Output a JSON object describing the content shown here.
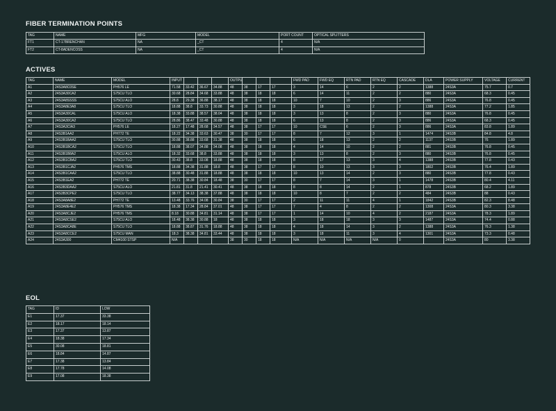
{
  "sections": {
    "ftp": "FIBER TERMINATION POINTS",
    "actives": "ACTIVES",
    "eol": "EOL"
  },
  "ftp": {
    "headers": [
      "TAG",
      "NAME",
      "MFG",
      "MODEL",
      "PORT COUNT",
      "OPTICAL SPLITTERS"
    ],
    "rows": [
      [
        "FT1",
        "CT-17BRENCHAN",
        "NA",
        "_CT",
        "4",
        "N/A"
      ],
      [
        "FT2",
        "CT-8ADENCOSS",
        "NA",
        "_CT",
        "4",
        "N/A"
      ]
    ]
  },
  "actives": {
    "headers": [
      "TAG",
      "NAME",
      "MODEL",
      "INPUT",
      "",
      "",
      "",
      "OUTPUT",
      "",
      "",
      "",
      "FWD PAD",
      "FWD EQ",
      "RTN PAD",
      "RTN EQ",
      "CASCADE",
      "DLA",
      "POWER SUPPLY",
      "VOLTAGE",
      "CURRENT"
    ],
    "rows": [
      [
        "A1",
        "24S3A8C0SE",
        "PH576 LE",
        "71.58",
        "33.42",
        "36.67",
        "34.88",
        "48",
        "38",
        "17",
        "17",
        "3",
        "14",
        "6",
        "2",
        "2",
        "1388",
        "24S3A",
        "75.7",
        "0.7"
      ],
      [
        "A2",
        "24S3A30CA2",
        "S75CU TLO",
        "30.68",
        "28.84",
        "34.68",
        "33.88",
        "48",
        "38",
        "18",
        "18",
        "6",
        "14",
        "11",
        "2",
        "2",
        "880",
        "24S3A",
        "68.3",
        "0.45"
      ],
      [
        "A3",
        "24S3A8SSSS",
        "S75CU ALO",
        "28.8",
        "29.38",
        "36.88",
        "38.17",
        "48",
        "38",
        "18",
        "18",
        "10",
        "7",
        "10",
        "2",
        "3",
        "886",
        "24S3A",
        "76.8",
        "0.45"
      ],
      [
        "A4",
        "24S3A8E3A8",
        "S75CU TLO",
        "18.88",
        "38.8",
        "33.73",
        "30.88",
        "48",
        "38",
        "18",
        "18",
        "3",
        "18",
        "13",
        "2",
        "2",
        "1388",
        "24S3A",
        "77.2",
        "1.85"
      ],
      [
        "A5",
        "24S3A30CAL",
        "S75CU ALO",
        "18.38",
        "33.88",
        "38.57",
        "38.04",
        "48",
        "38",
        "18",
        "18",
        "3",
        "13",
        "8",
        "2",
        "3",
        "880",
        "24S3A",
        "76.8",
        "0.45"
      ],
      [
        "A6",
        "24S3A30CA2",
        "S75CU TLO",
        "28.86",
        "38.47",
        "33.48",
        "30.88",
        "48",
        "38",
        "18",
        "18",
        "6",
        "13",
        "8",
        "2",
        "3",
        "886",
        "24S3A",
        "68.3",
        "0.45"
      ],
      [
        "A7",
        "24S3A3CIA3",
        "PH576 LE",
        "18.27",
        "17.48",
        "28.68",
        "34.57",
        "48",
        "38",
        "17",
        "17",
        "10",
        "CSE",
        "6",
        "2",
        "3",
        "886",
        "24S3A",
        "83.8",
        "1.89"
      ],
      [
        "A8",
        "24S3B1AA2",
        "PH772 TE",
        "18.22",
        "34.38",
        "33.63",
        "30.47",
        "38",
        "30",
        "17",
        "17",
        "8",
        "7",
        "12",
        "3",
        "1",
        "1474",
        "24S3B",
        "84.8",
        "4.8"
      ],
      [
        "A9",
        "24S3B1BAA2",
        "S75CU TLO",
        "30.88",
        "38.88",
        "33.68",
        "31.38",
        "48",
        "38",
        "18",
        "18",
        "6",
        "18",
        "13",
        "2",
        "2",
        "1137",
        "24S3B",
        "76",
        "1.89"
      ],
      [
        "A10",
        "24S3B1BCA2",
        "S75CU TLO",
        "18.88",
        "38.07",
        "34.88",
        "34.08",
        "48",
        "38",
        "18",
        "18",
        "4",
        "14",
        "10",
        "2",
        "2",
        "881",
        "24S3B",
        "76.8",
        "0.45"
      ],
      [
        "A11",
        "24S3B1B8A2",
        "S75CU ALO",
        "18.32",
        "33.68",
        "38.8",
        "33.88",
        "48",
        "38",
        "18",
        "18",
        "3",
        "13",
        "8",
        "2",
        "3",
        "880",
        "24S3B",
        "76.8",
        "0.45"
      ],
      [
        "A12",
        "24S3B1CBA2",
        "S75CU TLO",
        "30.43",
        "38.8",
        "33.08",
        "18.88",
        "48",
        "38",
        "18",
        "18",
        "8",
        "17",
        "13",
        "3",
        "4",
        "1388",
        "24S3B",
        "77.8",
        "0.43"
      ],
      [
        "A13",
        "24S3B1CJA2",
        "PH576 TMS",
        "18.88",
        "34.38",
        "31.88",
        "18.8",
        "48",
        "38",
        "17",
        "17",
        "8",
        "10",
        "13",
        "3",
        "3",
        "1802",
        "24S3B",
        "76.4",
        "1.89"
      ],
      [
        "A14",
        "24S3B1CAA2",
        "S75CU TLO",
        "38.88",
        "30.48",
        "31.88",
        "18.88",
        "48",
        "38",
        "18",
        "18",
        "10",
        "13",
        "14",
        "2",
        "3",
        "880",
        "24S3B",
        "77.8",
        "0.43"
      ],
      [
        "A15",
        "24S3B1EA2",
        "PH772 TE",
        "20.71",
        "38.38",
        "30.84",
        "18.48",
        "38",
        "30",
        "17",
        "17",
        "8",
        "7",
        "14",
        "3",
        "1",
        "1478",
        "24S3B",
        "80.4",
        "4.11"
      ],
      [
        "A16",
        "24S3B3DAA2",
        "S75CU ALO",
        "21.81",
        "31.8",
        "21.41",
        "30.41",
        "48",
        "38",
        "18",
        "18",
        "8",
        "8",
        "14",
        "2",
        "1",
        "878",
        "24S3B",
        "68.2",
        "1.89"
      ],
      [
        "A17",
        "24S3B3CPE2",
        "S75CU TLO",
        "38.77",
        "34.13",
        "38.38",
        "37.88",
        "48",
        "38",
        "18",
        "18",
        "10",
        "8",
        "7",
        "2",
        "2",
        "484",
        "24S3B",
        "88",
        "0.43"
      ],
      [
        "A18",
        "24S3A8A8E2",
        "PH772 TE",
        "13.48",
        "33.76",
        "34.08",
        "30.84",
        "38",
        "30",
        "17",
        "17",
        "2",
        "11",
        "11",
        "4",
        "1",
        "1842",
        "24S3B",
        "82.3",
        "8.48"
      ],
      [
        "A19",
        "24S3A8E4E2",
        "PH576 TMS",
        "18.38",
        "17.34",
        "28.84",
        "37.01",
        "48",
        "38",
        "17",
        "17",
        "7",
        "4",
        "8",
        "2",
        "2",
        "1308",
        "24S3A",
        "80.3",
        "3.38"
      ],
      [
        "A20",
        "24S3A8CJE2",
        "PH576 TMS",
        "8.18",
        "30.88",
        "34.81",
        "31.14",
        "48",
        "38",
        "17",
        "17",
        "1",
        "14",
        "10",
        "4",
        "2",
        "2187",
        "24S3A",
        "78.3",
        "1.89"
      ],
      [
        "A21",
        "24S3A8CSE2",
        "S75CU ALO",
        "18.48",
        "38.38",
        "30.88",
        "18",
        "48",
        "38",
        "18",
        "18",
        "3",
        "18",
        "18",
        "3",
        "3",
        "1487",
        "24S3A",
        "74.4",
        "0.88"
      ],
      [
        "A22",
        "24S3A8CA8E",
        "S75CU TLO",
        "18.88",
        "38.87",
        "31.76",
        "18.88",
        "48",
        "38",
        "18",
        "18",
        "4",
        "18",
        "14",
        "3",
        "2",
        "1388",
        "24S3A",
        "76.3",
        "1.38"
      ],
      [
        "A23",
        "24S3A8CCE2",
        "S75CU MAN",
        "18.3",
        "38.38",
        "34.81",
        "33.44",
        "48",
        "38",
        "18",
        "18",
        "3",
        "18",
        "11",
        "3",
        "4",
        "1301",
        "24S3A",
        "73.3",
        "0.48"
      ],
      [
        "A24",
        "24S3A300",
        "CM4100 STSP",
        "N/A",
        "",
        "",
        "",
        "38",
        "30",
        "18",
        "18",
        "N/A",
        "N/A",
        "N/A",
        "N/A",
        "0",
        "",
        "24S3A",
        "80",
        "3.38"
      ]
    ]
  },
  "eol": {
    "headers": [
      "TAG",
      "ID",
      "LOW"
    ],
    "rows": [
      [
        "E1",
        "17.37",
        "33.38"
      ],
      [
        "E2",
        "18.17",
        "18.14"
      ],
      [
        "E3",
        "17.37",
        "13.87"
      ],
      [
        "E4",
        "18.38",
        "17.34"
      ],
      [
        "E5",
        "30.08",
        "18.81"
      ],
      [
        "E6",
        "18.84",
        "14.87"
      ],
      [
        "E7",
        "17.38",
        "13.84"
      ],
      [
        "E8",
        "17.78",
        "14.08"
      ],
      [
        "E9",
        "17.08",
        "18.38"
      ]
    ]
  }
}
